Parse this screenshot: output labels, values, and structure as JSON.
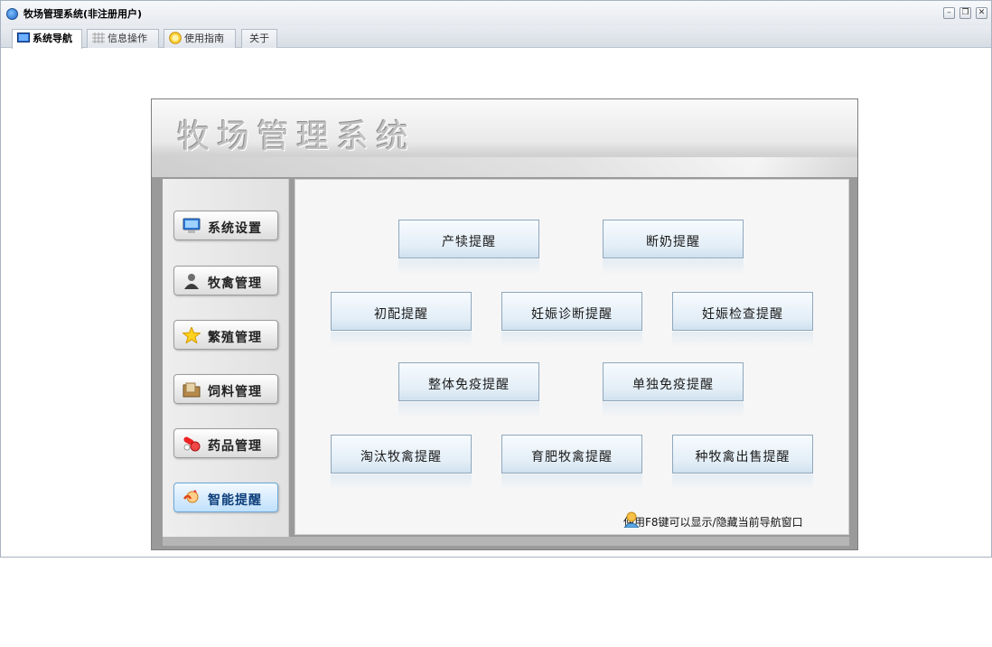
{
  "window": {
    "title": "牧场管理系统(非注册用户)",
    "controls": [
      "minimize",
      "restore",
      "close"
    ]
  },
  "tabs": [
    {
      "label": "系统导航",
      "icon": "monitor-icon",
      "active": true
    },
    {
      "label": "信息操作",
      "icon": "grid-icon",
      "active": false
    },
    {
      "label": "使用指南",
      "icon": "help-icon",
      "active": false
    },
    {
      "label": "关于",
      "icon": "",
      "active": false
    }
  ],
  "banner": {
    "title": "牧场管理系统"
  },
  "sidebar": {
    "items": [
      {
        "label": "系统设置",
        "icon": "computer-icon",
        "active": false
      },
      {
        "label": "牧禽管理",
        "icon": "person-icon",
        "active": false
      },
      {
        "label": "繁殖管理",
        "icon": "star-icon",
        "active": false
      },
      {
        "label": "饲料管理",
        "icon": "folder-icon",
        "active": false
      },
      {
        "label": "药品管理",
        "icon": "pills-icon",
        "active": false
      },
      {
        "label": "智能提醒",
        "icon": "reminder-icon",
        "active": true
      }
    ]
  },
  "reminders": {
    "row1": [
      "产犊提醒",
      "断奶提醒"
    ],
    "row2": [
      "初配提醒",
      "妊娠诊断提醒",
      "妊娠检查提醒"
    ],
    "row3": [
      "整体免疫提醒",
      "单独免疫提醒"
    ],
    "row4": [
      "淘汰牧禽提醒",
      "育肥牧禽提醒",
      "种牧禽出售提醒"
    ]
  },
  "hint": {
    "text": "使用F8键可以显示/隐藏当前导航窗口",
    "icon": "user-hint-icon"
  },
  "colors": {
    "accent": "#bfe0fb",
    "button_border": "#8fa7bd",
    "panel_gray": "#9a9a9a"
  }
}
